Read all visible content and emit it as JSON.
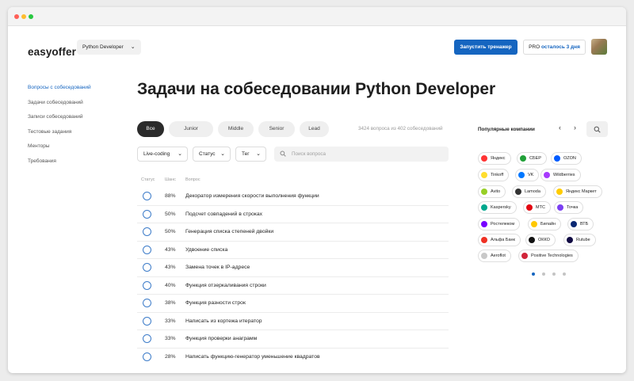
{
  "header": {
    "logo": "easyoffer",
    "role": "Python Developer",
    "start_button": "Запустить тренажер",
    "pro_label": "PRO",
    "pro_days": "осталось 3 дня"
  },
  "sidebar": {
    "items": [
      {
        "label": "Вопросы с собеседований",
        "active": true
      },
      {
        "label": "Задачи собеседований"
      },
      {
        "label": "Записи собеседований"
      },
      {
        "label": "Тестовые задания"
      },
      {
        "label": "Менторы"
      },
      {
        "label": "Требования"
      }
    ]
  },
  "main": {
    "title": "Задачи на собеседовании Python Developer",
    "levels": [
      "Все",
      "Junior",
      "Middle",
      "Senior",
      "Lead"
    ],
    "count_text": "3424 вопроса из 402 собеседований",
    "filters": [
      "Live-coding",
      "Статус",
      "Тег"
    ],
    "search_placeholder": "Поиск вопроса",
    "columns": {
      "status": "Статус",
      "chance": "Шанс",
      "question": "Вопрос"
    },
    "rows": [
      {
        "pct": "88%",
        "q": "Декоратор измерения скорости выполнения функции"
      },
      {
        "pct": "50%",
        "q": "Подсчет совпадений в строках"
      },
      {
        "pct": "50%",
        "q": "Генерация списка степеней двойки"
      },
      {
        "pct": "43%",
        "q": "Удвоение списка"
      },
      {
        "pct": "43%",
        "q": "Замена точек в IP-адресе"
      },
      {
        "pct": "40%",
        "q": "Функция отзеркаливания строки"
      },
      {
        "pct": "38%",
        "q": "Функция разности строк"
      },
      {
        "pct": "33%",
        "q": "Написать из кортежа итератор"
      },
      {
        "pct": "33%",
        "q": "Функция проверки анаграмм"
      },
      {
        "pct": "28%",
        "q": "Написать функцию-генератор уменьшение квадратов"
      }
    ]
  },
  "companies": {
    "title": "Популярные компании",
    "items": [
      {
        "name": "Яндекс",
        "color": "#f33"
      },
      {
        "name": "СБЕР",
        "color": "#21a038"
      },
      {
        "name": "OZON",
        "color": "#005bff"
      },
      {
        "name": "Tinkoff",
        "color": "#ffdd2d"
      },
      {
        "name": "VK",
        "color": "#0077ff"
      },
      {
        "name": "Wildberries",
        "color": "#a73afd"
      },
      {
        "name": "Avito",
        "color": "#97cf26"
      },
      {
        "name": "Lamoda",
        "color": "#333333"
      },
      {
        "name": "Яндекс Маркет",
        "color": "#ffcc00"
      },
      {
        "name": "Kaspersky",
        "color": "#00a88e"
      },
      {
        "name": "МТС",
        "color": "#e30611"
      },
      {
        "name": "Точка",
        "color": "#7b3ff2"
      },
      {
        "name": "Ростелеком",
        "color": "#7700ff"
      },
      {
        "name": "Билайн",
        "color": "#ffc800"
      },
      {
        "name": "ВТБ",
        "color": "#0a2973"
      },
      {
        "name": "Альфа Банк",
        "color": "#ef3124"
      },
      {
        "name": "ОККО",
        "color": "#111111"
      },
      {
        "name": "Rutube",
        "color": "#100943"
      },
      {
        "name": "Aeroflot",
        "color": "#c8c8c8"
      },
      {
        "name": "Positive Technologies",
        "color": "#d1253a"
      }
    ]
  }
}
